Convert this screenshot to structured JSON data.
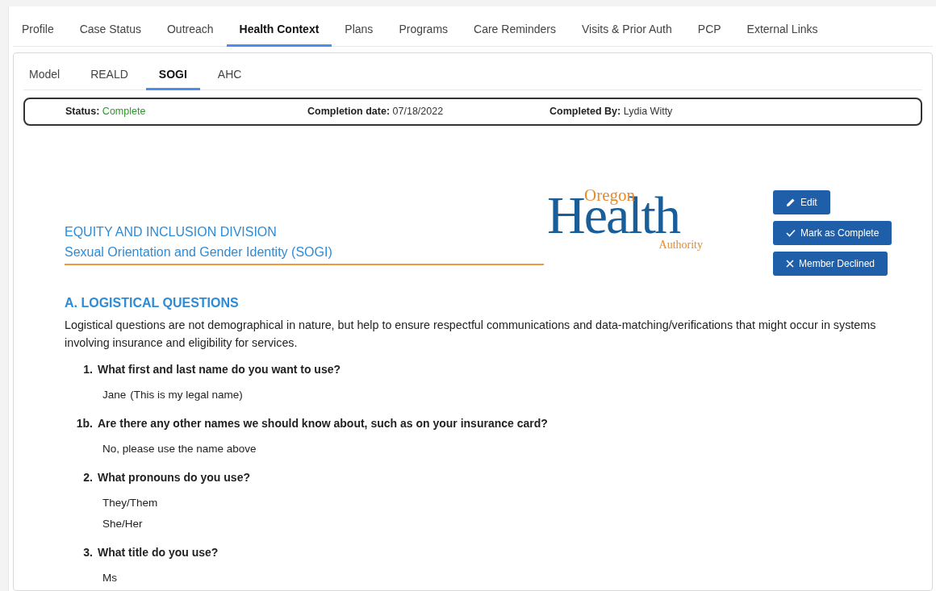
{
  "main_tabs": [
    {
      "label": "Profile",
      "selected": false
    },
    {
      "label": "Case Status",
      "selected": false
    },
    {
      "label": "Outreach",
      "selected": false
    },
    {
      "label": "Health Context",
      "selected": true
    },
    {
      "label": "Plans",
      "selected": false
    },
    {
      "label": "Programs",
      "selected": false
    },
    {
      "label": "Care Reminders",
      "selected": false
    },
    {
      "label": "Visits & Prior Auth",
      "selected": false
    },
    {
      "label": "PCP",
      "selected": false
    },
    {
      "label": "External Links",
      "selected": false
    }
  ],
  "sub_tabs": [
    {
      "label": "Model",
      "selected": false
    },
    {
      "label": "REALD",
      "selected": false
    },
    {
      "label": "SOGI",
      "selected": true
    },
    {
      "label": "AHC",
      "selected": false
    }
  ],
  "status_bar": [
    {
      "label": "Status:",
      "value": "Complete",
      "kind": "status"
    },
    {
      "label": "Completion date:",
      "value": "07/18/2022",
      "kind": "text"
    },
    {
      "label": "Completed By:",
      "value": "Lydia Witty",
      "kind": "text"
    }
  ],
  "header": {
    "division": "EQUITY AND INCLUSION DIVISION",
    "title": "Sexual Orientation and Gender Identity (SOGI)",
    "logo": {
      "top": "Oregon",
      "main": "Health",
      "bottom": "Authority"
    }
  },
  "actions": [
    {
      "label": "Edit",
      "kind": "edit"
    },
    {
      "label": "Mark as Complete",
      "kind": "complete"
    },
    {
      "label": "Member Declined",
      "kind": "decline"
    }
  ],
  "section": {
    "title": "A. LOGISTICAL QUESTIONS",
    "description": "Logistical questions are not demographical in nature, but help to ensure respectful communications and data-matching/verifications that might occur in systems involving insurance and eligibility for services.",
    "questions": [
      {
        "number": "1.",
        "text": "What first and last name do you want to use?",
        "answers": [
          [
            "Jane",
            "(This is my legal name)"
          ]
        ]
      },
      {
        "number": "1b.",
        "text": "Are there any other names we should know about, such as on your insurance card?",
        "answers": [
          [
            "No, please use the name above"
          ]
        ]
      },
      {
        "number": "2.",
        "text": "What pronouns do you use?",
        "answers": [
          [
            "They/Them"
          ],
          [
            "She/Her"
          ]
        ]
      },
      {
        "number": "3.",
        "text": "What title do you use?",
        "answers": [
          [
            "Ms"
          ]
        ]
      }
    ]
  }
}
